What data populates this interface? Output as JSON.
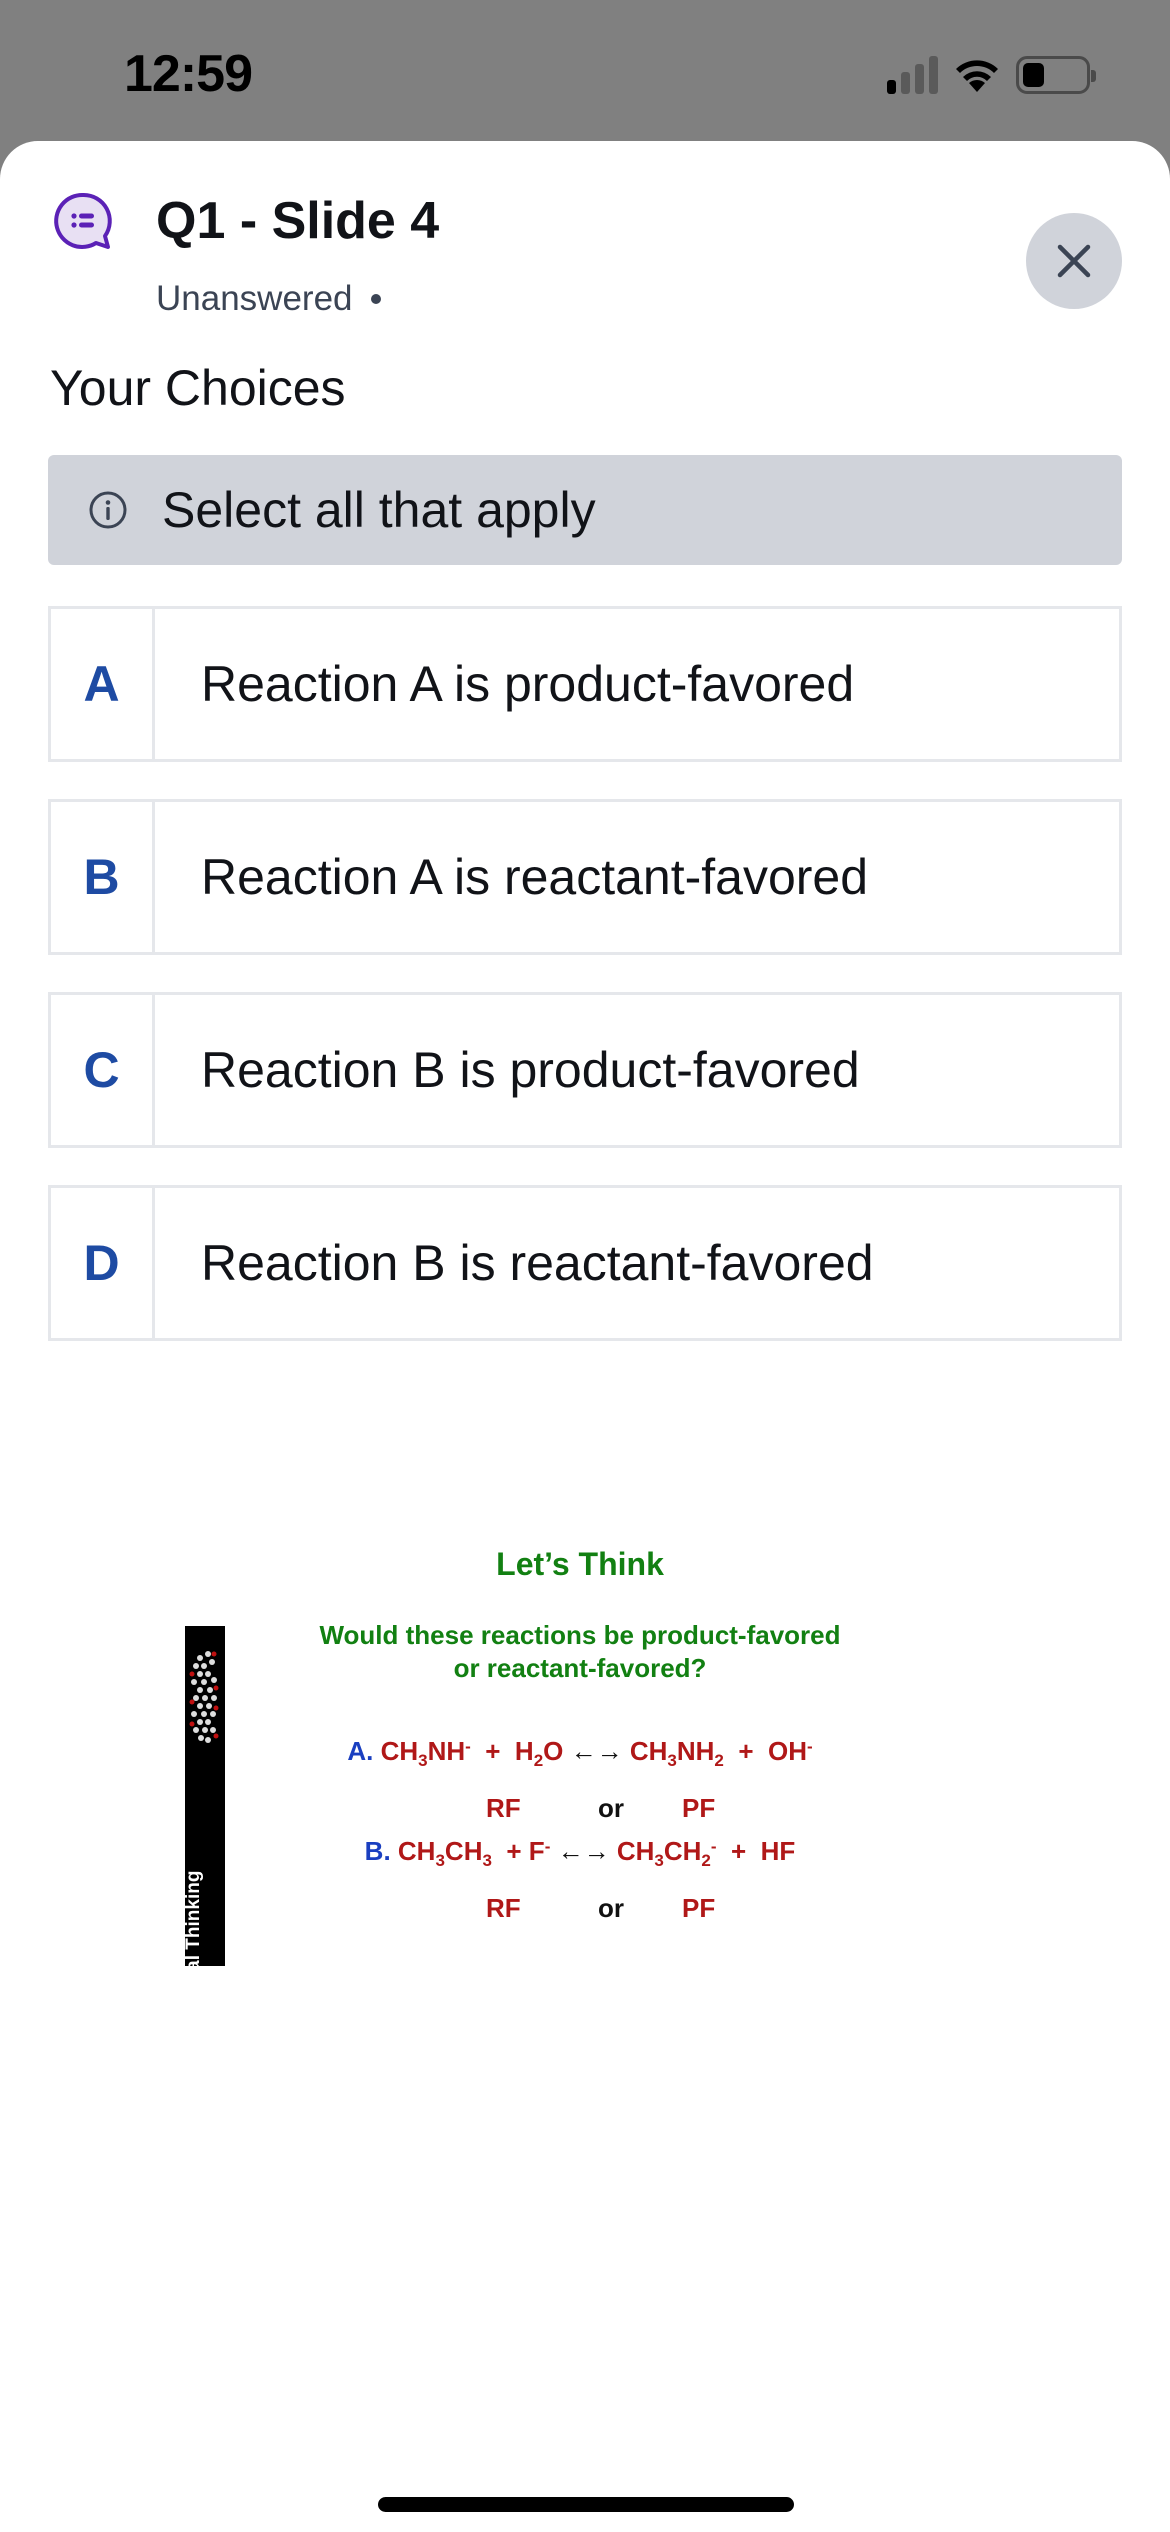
{
  "status_bar": {
    "time": "12:59",
    "icons": [
      "cellular-signal-icon",
      "wifi-icon",
      "battery-icon"
    ],
    "signal_bars_active": 1,
    "signal_bars_total": 4,
    "battery_level_fraction": 0.25
  },
  "header": {
    "icon": "poll-question-icon",
    "title": "Q1 - Slide 4",
    "status": "Unanswered",
    "close_icon": "close-icon"
  },
  "section_title": "Your Choices",
  "hint": {
    "icon": "info-icon",
    "text": "Select all that apply"
  },
  "choices": [
    {
      "letter": "A",
      "text": "Reaction A is product-favored"
    },
    {
      "letter": "B",
      "text": "Reaction A is reactant-favored"
    },
    {
      "letter": "C",
      "text": "Reaction B is product-favored"
    },
    {
      "letter": "D",
      "text": "Reaction B is reactant-favored"
    }
  ],
  "slide": {
    "sidebar_label": "Chemical Thinking",
    "title": "Let’s Think",
    "question_line1": "Would these reactions be product-favored",
    "question_line2": "or reactant-favored?",
    "reaction_a": {
      "label": "A.",
      "equation_text": "CH3NH- + H2O <-> CH3NH2 + OH-"
    },
    "reaction_b": {
      "label": "B.",
      "equation_text": "CH3CH3 + F- <-> CH3CH2- + HF"
    },
    "option_rf": "RF",
    "option_or": "or",
    "option_pf": "PF"
  },
  "colors": {
    "accent_purple": "#5b21b6",
    "choice_letter_blue": "#1e4ba3",
    "slide_green": "#128012",
    "slide_red": "#b01818",
    "slide_blue": "#1a3fc0",
    "hint_bg": "#d0d3da"
  }
}
